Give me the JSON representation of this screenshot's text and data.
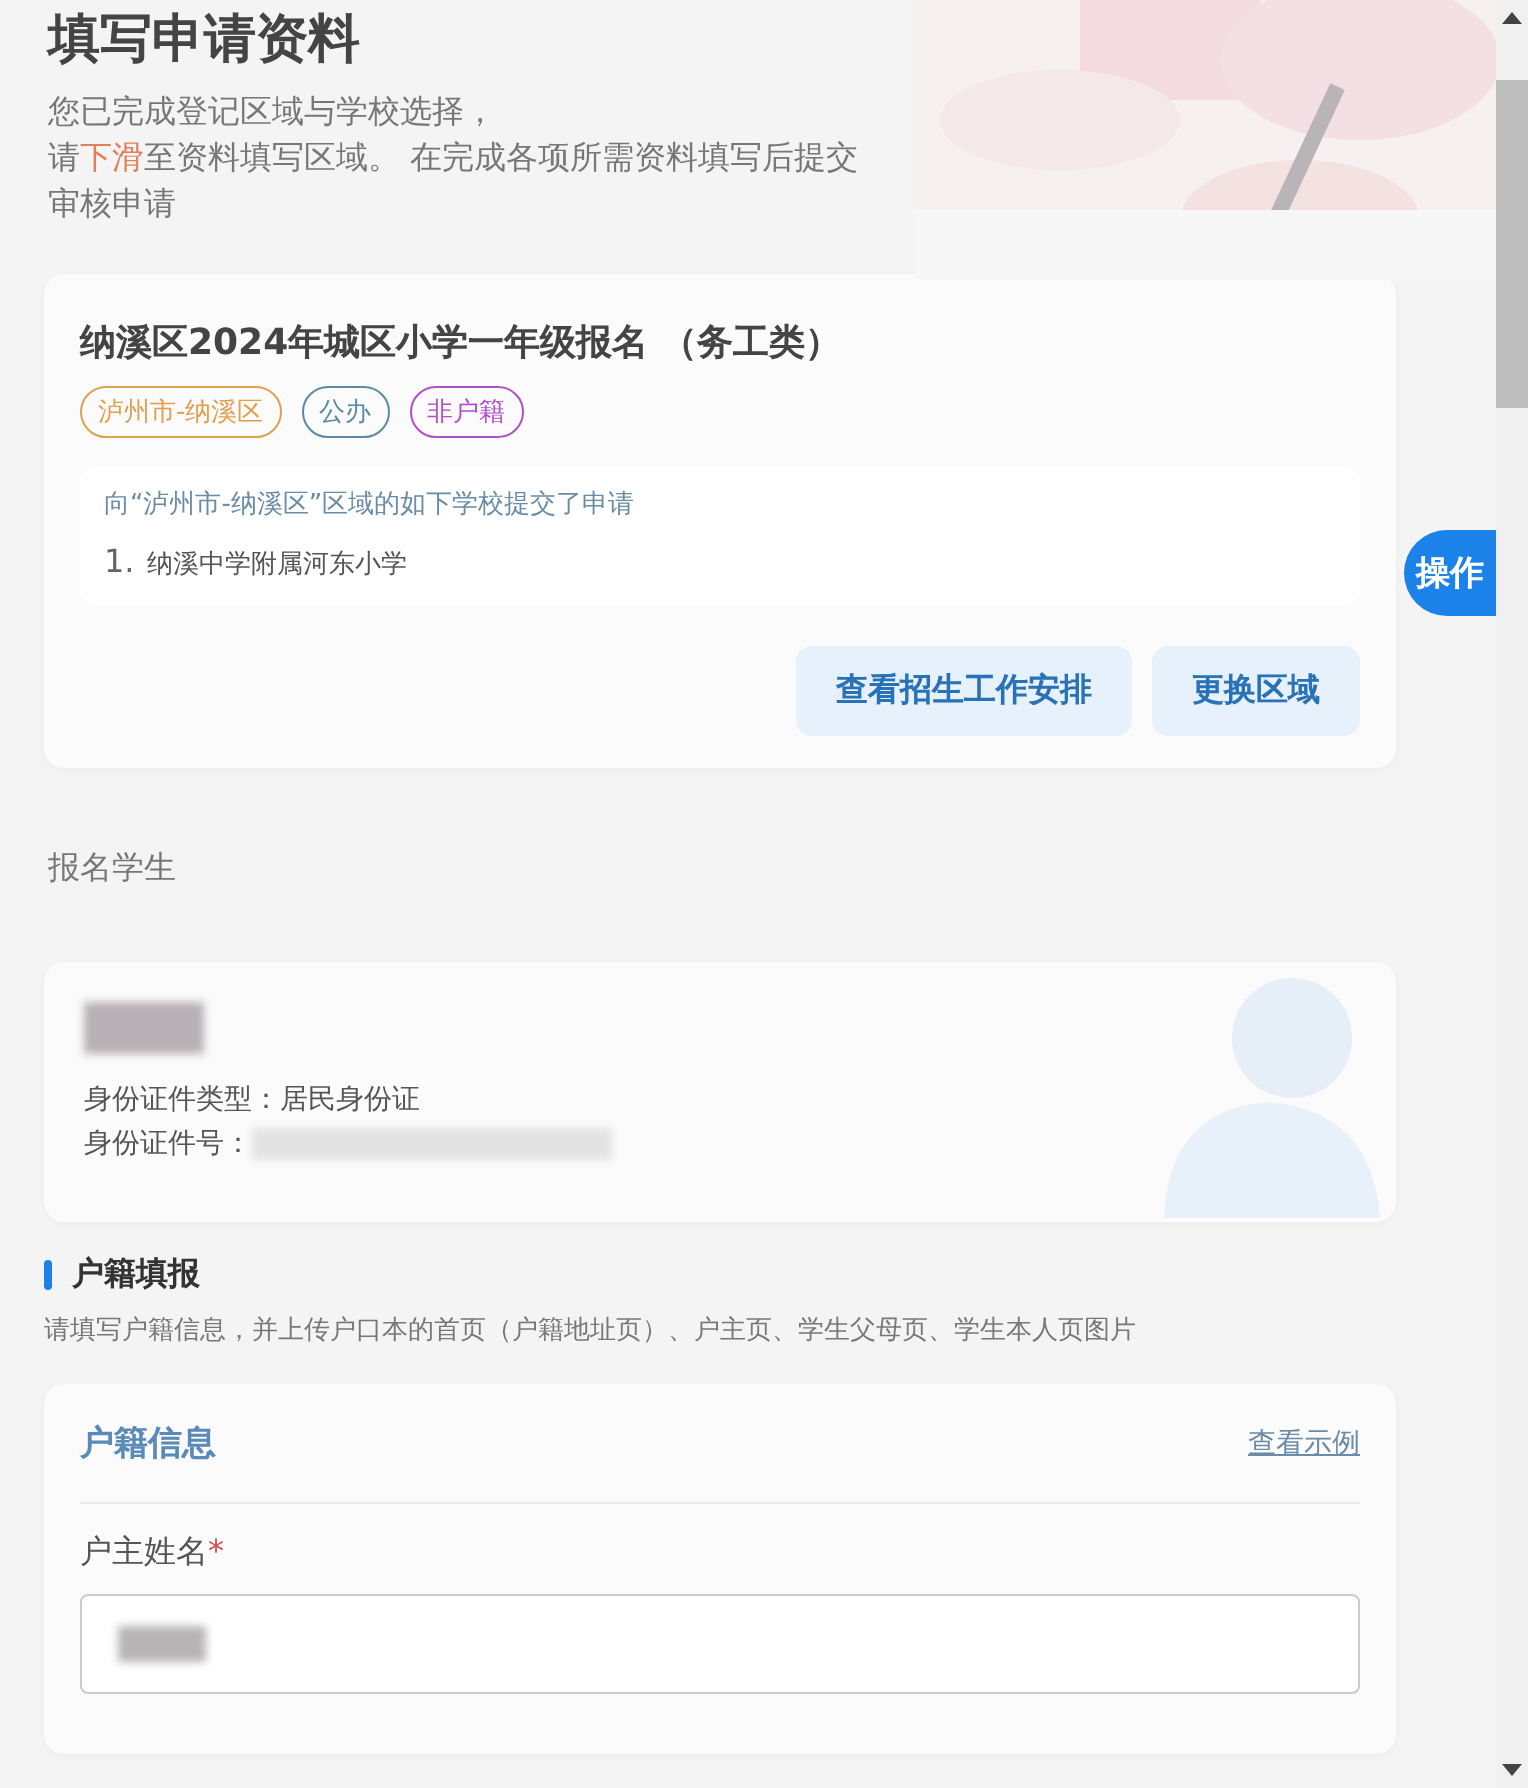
{
  "header": {
    "title": "填写申请资料",
    "lines": [
      [
        {
          "text": "您已完成登记区域与学校选择，",
          "highlight": false
        }
      ],
      [
        {
          "text": "请",
          "highlight": false
        },
        {
          "text": "下滑",
          "highlight": true
        },
        {
          "text": "至资料填写区域。 在完成各项所需资料填写后提交",
          "highlight": false
        }
      ],
      [
        {
          "text": "审核申请",
          "highlight": false
        }
      ]
    ]
  },
  "application": {
    "title": "纳溪区2024年城区小学一年级报名 （务工类）",
    "tags": [
      {
        "label": "泸州市-纳溪区",
        "color": "#e0a050"
      },
      {
        "label": "公办",
        "color": "#5a8aa8"
      },
      {
        "label": "非户籍",
        "color": "#b050c8"
      }
    ],
    "notice": "向“泸州市-纳溪区”区域的如下学校提交了申请",
    "schools": [
      {
        "number": "1.",
        "name": "纳溪中学附属河东小学"
      }
    ],
    "buttons": [
      "查看招生工作安排",
      "更换区域"
    ]
  },
  "float_button": "操作",
  "student_section": {
    "label": "报名学生",
    "student": {
      "name_redacted": true,
      "fields": [
        {
          "label": "身份证件类型：",
          "kind": "text",
          "value": "居民身份证"
        },
        {
          "label": "身份证件号：",
          "kind": "redacted"
        }
      ]
    }
  },
  "household": {
    "title": "户籍填报",
    "hint": "请填写户籍信息，并上传户口本的首页（户籍地址页）、户主页、学生父母页、学生本人页图片",
    "card": {
      "title": "户籍信息",
      "link": "查看示例",
      "field": {
        "label": "户主姓名",
        "required_mark": "*",
        "value_redacted": true
      }
    }
  }
}
